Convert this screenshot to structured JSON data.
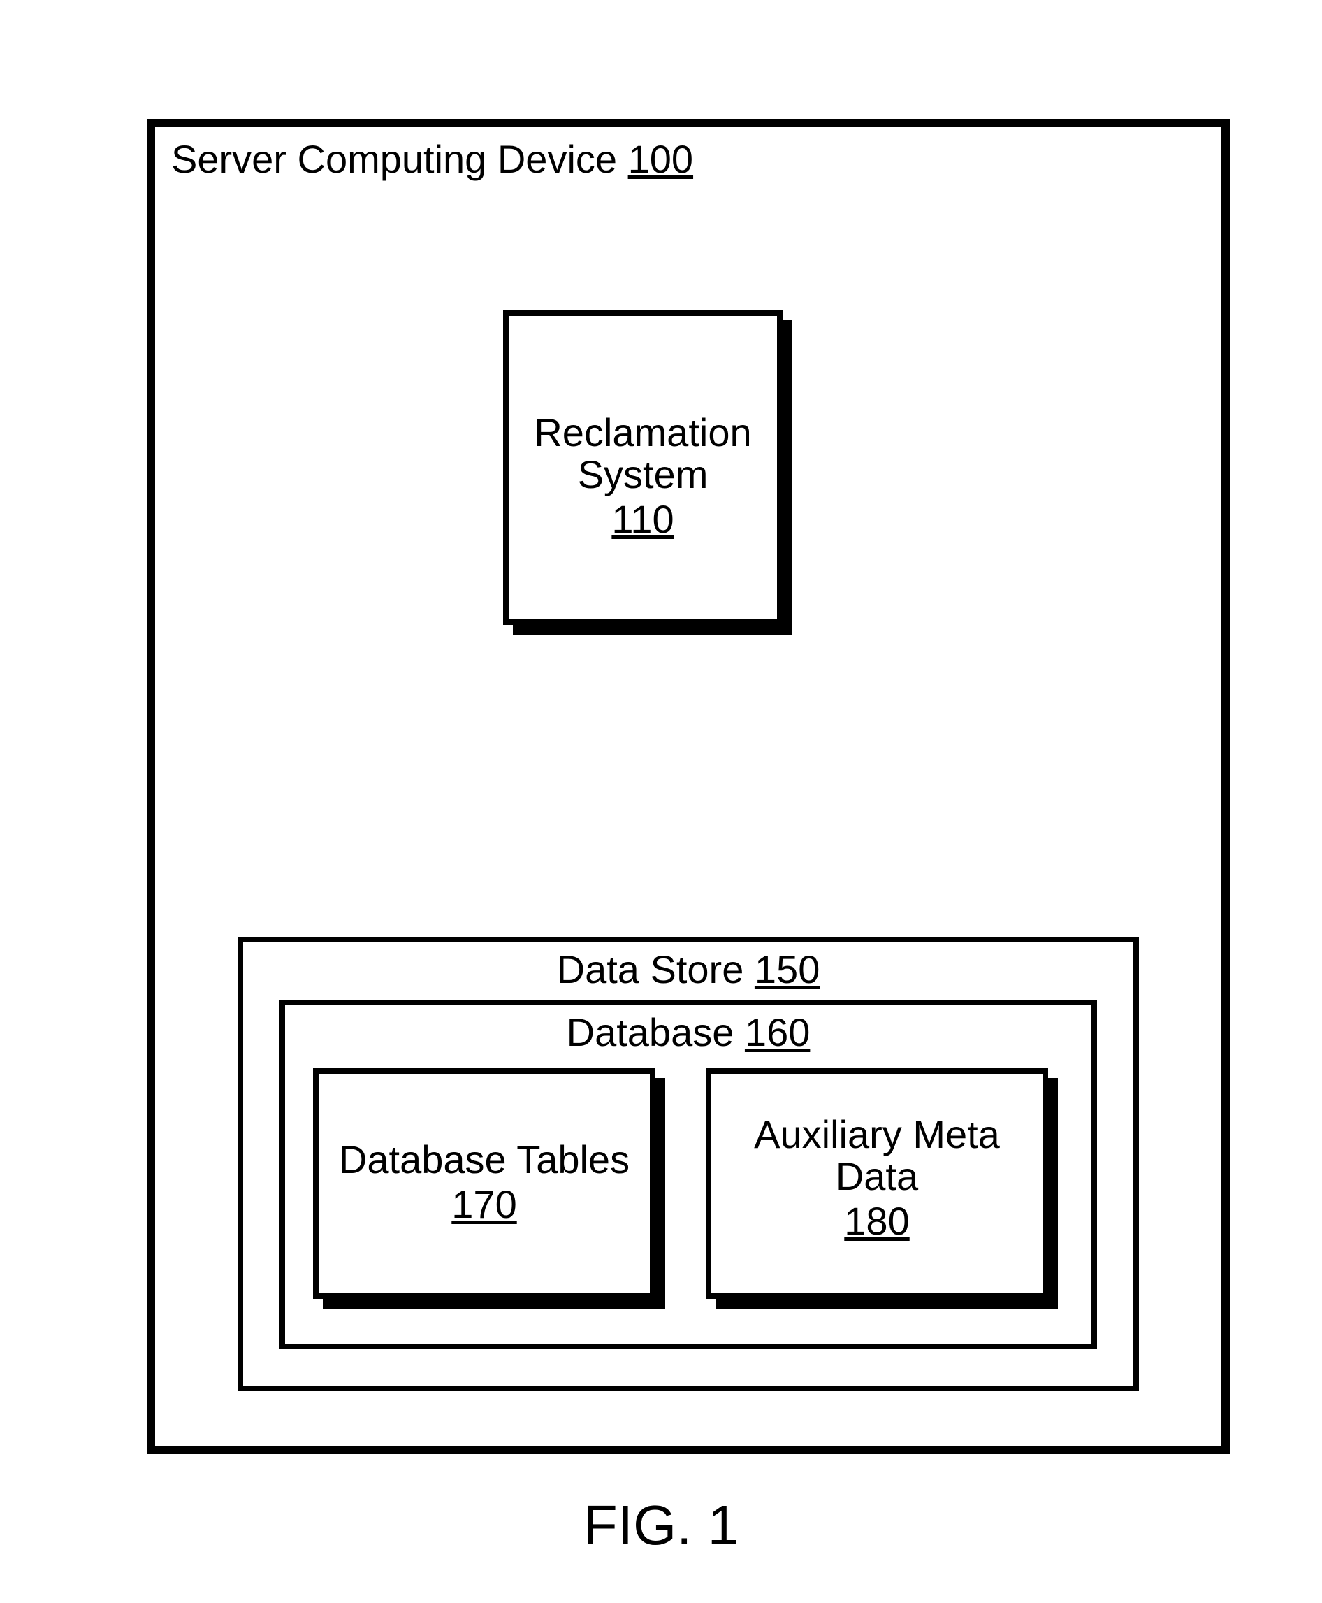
{
  "figure": {
    "caption": "FIG. 1"
  },
  "server": {
    "label": "Server Computing Device ",
    "num": "100"
  },
  "reclamation": {
    "line1": "Reclamation",
    "line2": "System",
    "num": "110"
  },
  "datastore": {
    "label": "Data Store ",
    "num": "150"
  },
  "database": {
    "label": "Database ",
    "num": "160"
  },
  "dbtables": {
    "line1": "Database Tables",
    "num": "170"
  },
  "auxmeta": {
    "line1": "Auxiliary Meta",
    "line2": "Data",
    "num": "180"
  }
}
